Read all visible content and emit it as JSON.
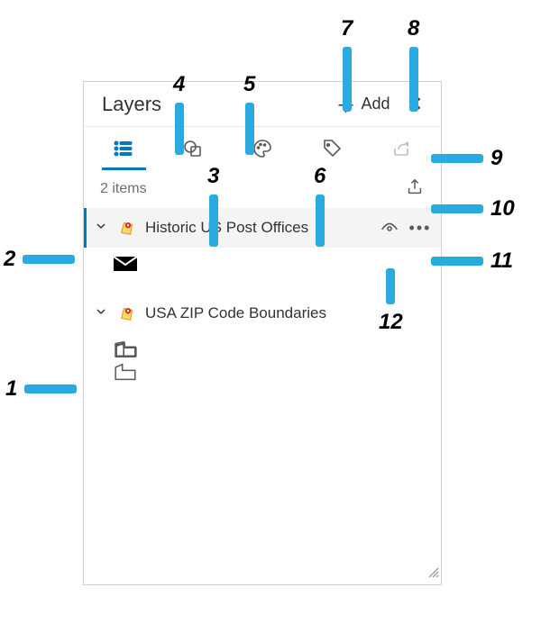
{
  "header": {
    "title": "Layers",
    "add_label": "Add"
  },
  "count_text": "2 items",
  "layers": [
    {
      "label": "Historic US Post Offices"
    },
    {
      "label": "USA ZIP Code Boundaries"
    }
  ],
  "callouts": {
    "c1": "1",
    "c2": "2",
    "c3": "3",
    "c4": "4",
    "c5": "5",
    "c6": "6",
    "c7": "7",
    "c8": "8",
    "c9": "9",
    "c10": "10",
    "c11": "11",
    "c12": "12"
  }
}
